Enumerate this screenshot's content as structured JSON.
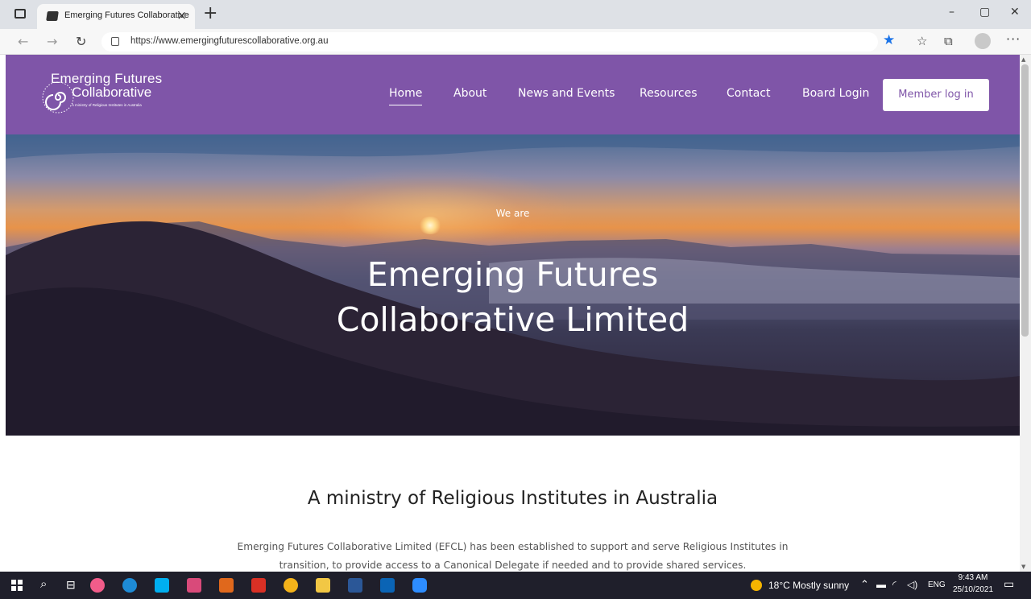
{
  "browser": {
    "tab_title": "Emerging Futures Collaborative",
    "tab_close": "×",
    "new_tab": "+",
    "url": "https://www.emergingfuturescollaborative.org.au",
    "win_minimize": "–",
    "win_restore": "▢",
    "win_close": "✕"
  },
  "site": {
    "logo": {
      "line1": "Emerging Futures",
      "line2": "Collaborative",
      "tagline": "A ministry of Religious Institutes in Australia"
    },
    "nav": [
      {
        "label": "Home",
        "active": true
      },
      {
        "label": "About"
      },
      {
        "label": "News and Events"
      },
      {
        "label": "Resources"
      },
      {
        "label": "Contact"
      },
      {
        "label": "Board Login"
      }
    ],
    "member_button": "Member log in",
    "brand_color": "#7f55a8"
  },
  "hero": {
    "intro": "We are",
    "title_line1": "Emerging Futures",
    "title_line2": "Collaborative Limited"
  },
  "section": {
    "title": "A ministry of Religious Institutes in Australia",
    "body_line1": "Emerging Futures Collaborative Limited (EFCL) has been established to support and serve Religious Institutes in",
    "body_line2": "transition, to provide access to a Canonical Delegate if needed and to provide shared services."
  },
  "taskbar": {
    "weather": "18°C  Mostly sunny",
    "lang": "ENG",
    "time": "9:43 AM",
    "date": "25/10/2021"
  }
}
